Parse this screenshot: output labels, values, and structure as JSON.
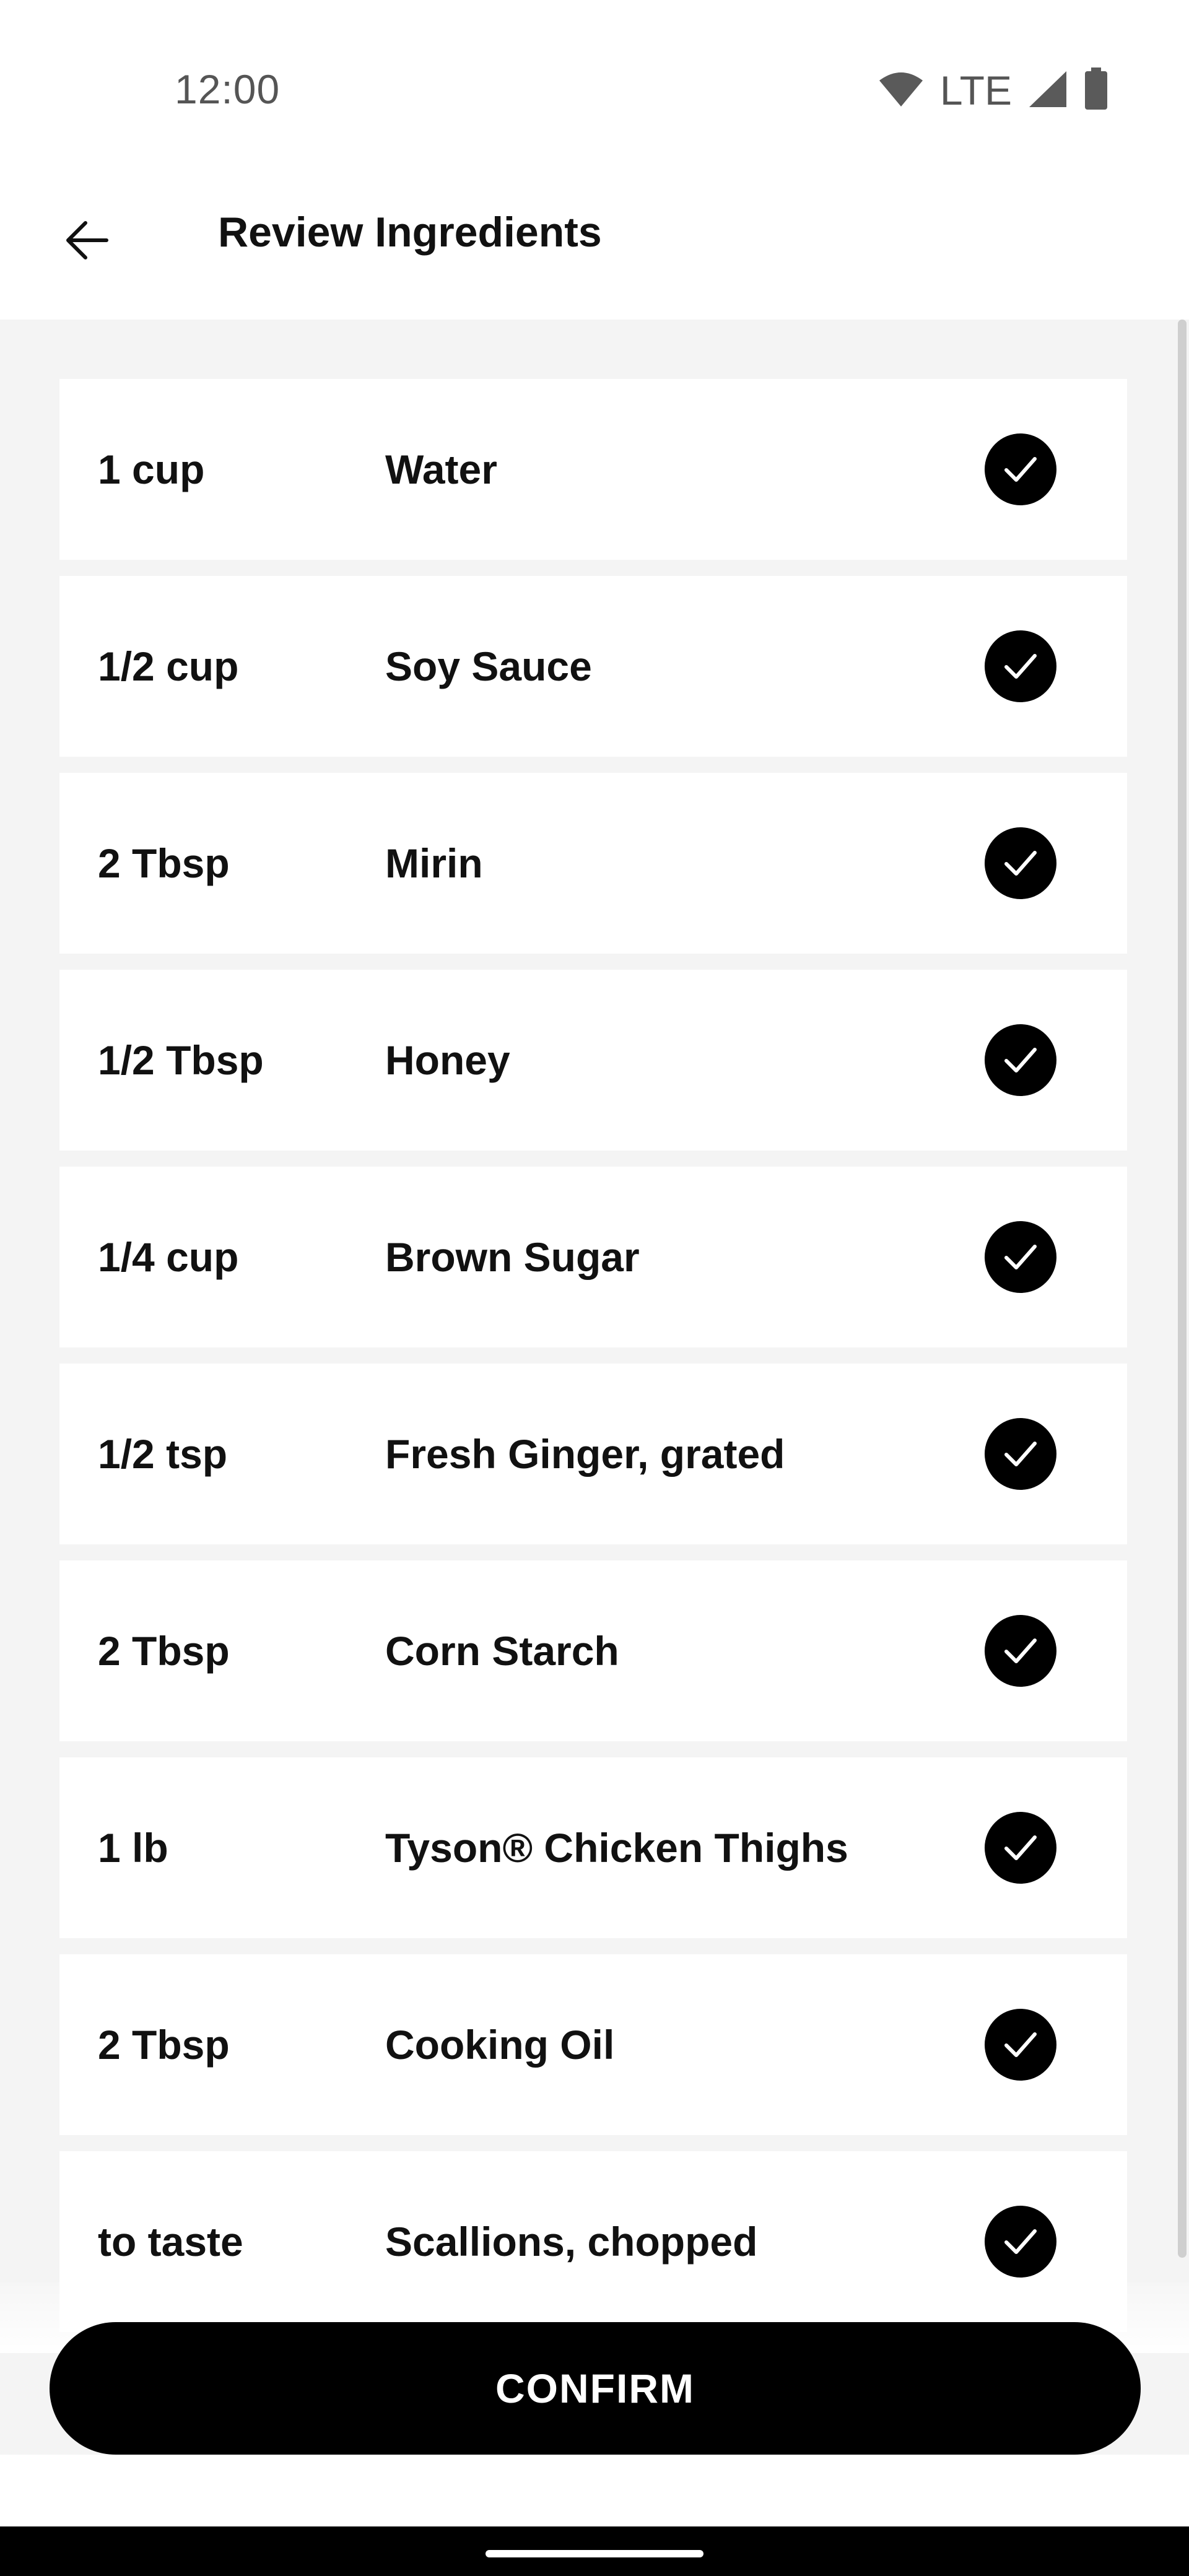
{
  "status_bar": {
    "time": "12:00",
    "network": "LTE",
    "icons": [
      "wifi-icon",
      "signal-icon",
      "battery-icon"
    ]
  },
  "app_bar": {
    "title": "Review Ingredients",
    "back_icon": "arrow-left-icon"
  },
  "ingredients": [
    {
      "qty": "1 cup",
      "name": "Water",
      "checked": true
    },
    {
      "qty": "1/2 cup",
      "name": "Soy Sauce",
      "checked": true
    },
    {
      "qty": "2 Tbsp",
      "name": "Mirin",
      "checked": true
    },
    {
      "qty": "1/2 Tbsp",
      "name": "Honey",
      "checked": true
    },
    {
      "qty": "1/4 cup",
      "name": "Brown Sugar",
      "checked": true
    },
    {
      "qty": "1/2 tsp",
      "name": "Fresh Ginger, grated",
      "checked": true
    },
    {
      "qty": "2 Tbsp",
      "name": "Corn Starch",
      "checked": true
    },
    {
      "qty": "1 lb",
      "name": "Tyson® Chicken Thighs",
      "checked": true
    },
    {
      "qty": "2 Tbsp",
      "name": "Cooking Oil",
      "checked": true
    },
    {
      "qty": "to taste",
      "name": "Scallions, chopped",
      "checked": true
    }
  ],
  "confirm_button": {
    "label": "CONFIRM"
  },
  "colors": {
    "accent": "#000000",
    "background": "#f4f4f4",
    "card": "#ffffff"
  }
}
